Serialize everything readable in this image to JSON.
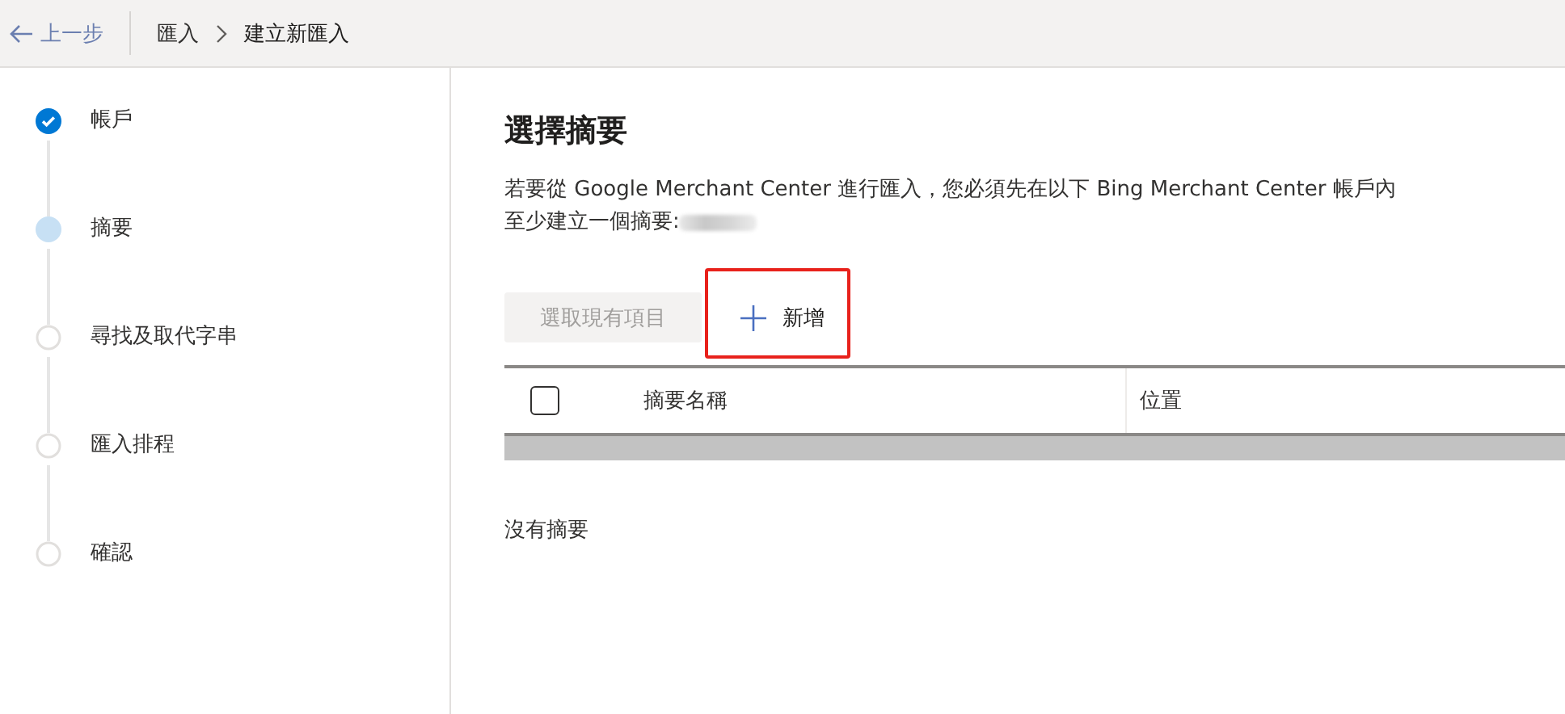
{
  "top_bar": {
    "back": "上一步",
    "breadcrumb": [
      {
        "label": "匯入",
        "current": false
      },
      {
        "label": "建立新匯入",
        "current": true
      }
    ]
  },
  "steps": [
    {
      "label": "帳戶",
      "kind": "done"
    },
    {
      "label": "摘要",
      "kind": "current"
    },
    {
      "label": "尋找及取代字串",
      "kind": "pending"
    },
    {
      "label": "匯入排程",
      "kind": "pending"
    },
    {
      "label": "確認",
      "kind": "pending"
    }
  ],
  "main": {
    "title": "選擇摘要",
    "description_line_1": "若要從 Google Merchant Center 進行匯入，您必須先在以下 Bing Merchant Center 帳戶內",
    "description_line_2": "至少建立一個摘要:",
    "buttons": [
      {
        "label": "選取現有項目",
        "kind": "select",
        "disabled": true,
        "highlighted": false
      },
      {
        "label": "新增",
        "kind": "add",
        "disabled": false,
        "highlighted": true
      }
    ],
    "table": {
      "select_all_checked": false,
      "columns": [
        "摘要名稱",
        "位置"
      ]
    },
    "empty_message": "沒有摘要"
  }
}
